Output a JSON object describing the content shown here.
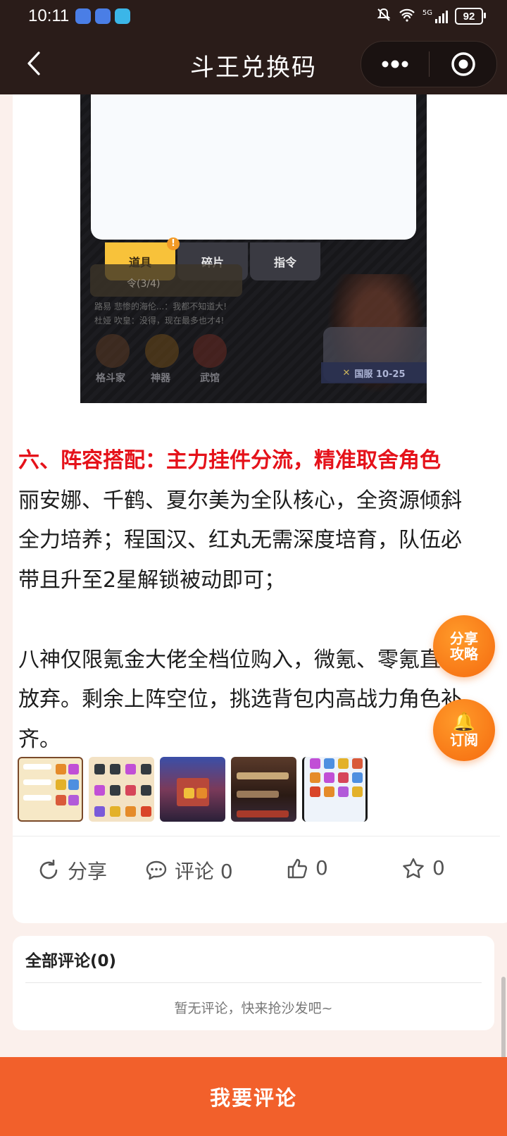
{
  "status_bar": {
    "time": "10:11",
    "network": "5G",
    "battery": "92"
  },
  "nav": {
    "title": "斗王兑换码",
    "more_label": "•••"
  },
  "embedded_screenshot": {
    "tabs": [
      "道具",
      "碎片",
      "指令"
    ],
    "badge": "!",
    "ticket_text": "令(3/4)",
    "chat_lines": [
      "路易  悲惨的海伦...：我都不知道大!",
      "杜娅  吹皇：没得，现在最多也才4!"
    ],
    "bottom_labels": [
      "格斗家",
      "神器",
      "武馆"
    ],
    "date_tag": "国服 10-25"
  },
  "article": {
    "heading": "六、阵容搭配：主力挂件分流，精准取舍角色",
    "paragraph1": "丽安娜、千鹤、夏尔美为全队核心，全资源倾斜全力培养；程国汉、红丸无需深度培育，队伍必带且升至2星解锁被动即可；",
    "paragraph2": "八神仅限氪金大佬全档位购入，微氪、零氪直接放弃。剩余上阵空位，挑选背包内高战力角色补齐。"
  },
  "actions": {
    "share": "分享",
    "comment": "评论 0",
    "like": "0",
    "favorite": "0"
  },
  "comments": {
    "title": "全部评论(0)",
    "empty": "暂无评论，快来抢沙发吧~"
  },
  "floating": {
    "guide_line1": "分享",
    "guide_line2": "攻略",
    "subscribe": "订阅"
  },
  "bottom_button": "我要评论",
  "colors": {
    "accent": "#f2602b",
    "heading_red": "#e5121a",
    "header_bg": "#2a1c19"
  }
}
